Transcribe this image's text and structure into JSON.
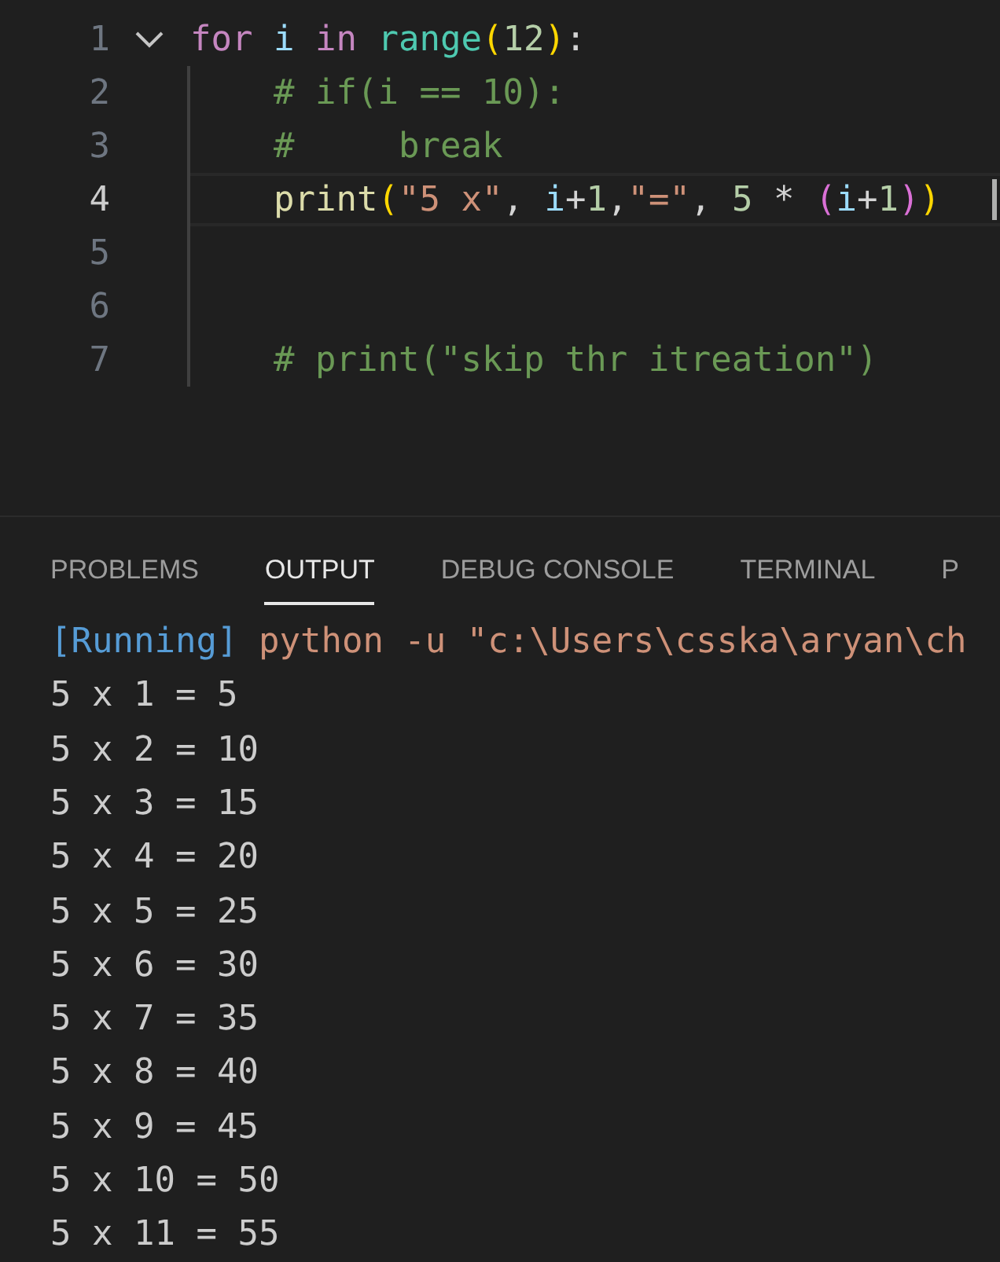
{
  "editor": {
    "lines": [
      {
        "number": "1",
        "foldable": true,
        "indented": false,
        "active": false,
        "tokens": [
          {
            "kind": "keyword",
            "text": "for "
          },
          {
            "kind": "variable",
            "text": "i "
          },
          {
            "kind": "keyword",
            "text": "in "
          },
          {
            "kind": "type",
            "text": "range"
          },
          {
            "kind": "bracket1",
            "text": "("
          },
          {
            "kind": "number",
            "text": "12"
          },
          {
            "kind": "bracket1",
            "text": ")"
          },
          {
            "kind": "plain",
            "text": ":"
          }
        ]
      },
      {
        "number": "2",
        "foldable": false,
        "indented": true,
        "active": false,
        "tokens": [
          {
            "kind": "comment",
            "text": "# if(i == 10):"
          }
        ]
      },
      {
        "number": "3",
        "foldable": false,
        "indented": true,
        "active": false,
        "tokens": [
          {
            "kind": "comment",
            "text": "#     break"
          }
        ]
      },
      {
        "number": "4",
        "foldable": false,
        "indented": true,
        "active": true,
        "tokens": [
          {
            "kind": "function",
            "text": "print"
          },
          {
            "kind": "bracket1",
            "text": "("
          },
          {
            "kind": "string",
            "text": "\"5 x\""
          },
          {
            "kind": "plain",
            "text": ", "
          },
          {
            "kind": "variable",
            "text": "i"
          },
          {
            "kind": "plain",
            "text": "+"
          },
          {
            "kind": "number",
            "text": "1"
          },
          {
            "kind": "plain",
            "text": ","
          },
          {
            "kind": "string",
            "text": "\"=\""
          },
          {
            "kind": "plain",
            "text": ", "
          },
          {
            "kind": "number",
            "text": "5"
          },
          {
            "kind": "plain",
            "text": " * "
          },
          {
            "kind": "bracket2",
            "text": "("
          },
          {
            "kind": "variable",
            "text": "i"
          },
          {
            "kind": "plain",
            "text": "+"
          },
          {
            "kind": "number",
            "text": "1"
          },
          {
            "kind": "bracket2",
            "text": ")"
          },
          {
            "kind": "bracket1",
            "text": ")"
          }
        ]
      },
      {
        "number": "5",
        "foldable": false,
        "indented": true,
        "active": false
      },
      {
        "number": "6",
        "foldable": false,
        "indented": true,
        "active": false
      },
      {
        "number": "7",
        "foldable": false,
        "indented": true,
        "active": false,
        "tokens": [
          {
            "kind": "comment",
            "text": "# print(\"skip thr itreation\")"
          }
        ]
      }
    ]
  },
  "panel": {
    "tabs": [
      {
        "label": "PROBLEMS",
        "selected": false
      },
      {
        "label": "OUTPUT",
        "selected": true
      },
      {
        "label": "DEBUG CONSOLE",
        "selected": false
      },
      {
        "label": "TERMINAL",
        "selected": false
      },
      {
        "label": "P",
        "selected": false
      }
    ],
    "output": {
      "status": "[Running]",
      "command": "python -u \"c:\\Users\\csska\\aryan\\ch",
      "lines": [
        "5 x 1 = 5",
        "5 x 2 = 10",
        "5 x 3 = 15",
        "5 x 4 = 20",
        "5 x 5 = 25",
        "5 x 6 = 30",
        "5 x 7 = 35",
        "5 x 8 = 40",
        "5 x 9 = 45",
        "5 x 10 = 50",
        "5 x 11 = 55"
      ]
    }
  }
}
